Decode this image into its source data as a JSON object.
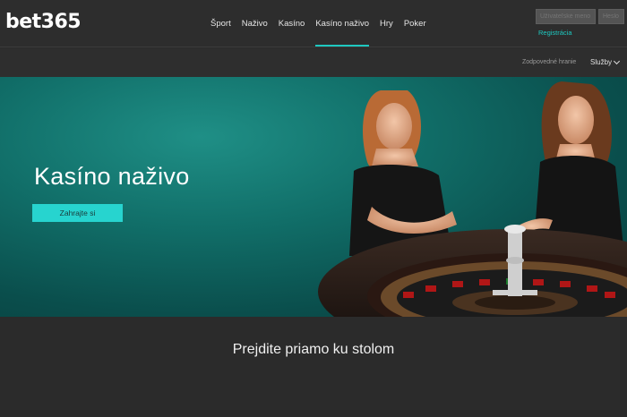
{
  "brand": {
    "logo": "bet365",
    "accent": "#1ec8c0"
  },
  "nav": {
    "items": [
      {
        "label": "Šport"
      },
      {
        "label": "Naživo"
      },
      {
        "label": "Kasíno"
      },
      {
        "label": "Kasíno naživo",
        "active": true
      },
      {
        "label": "Hry"
      },
      {
        "label": "Poker"
      }
    ]
  },
  "login": {
    "username_placeholder": "Užívateľské meno",
    "password_placeholder": "Heslo",
    "register_label": "Registrácia"
  },
  "subbar": {
    "responsible_label": "Zodpovedné hranie",
    "services_label": "Služby"
  },
  "hero": {
    "title": "Kasíno naživo",
    "button_label": "Zahrajte si"
  },
  "section": {
    "title": "Prejdite priamo ku stolom"
  }
}
